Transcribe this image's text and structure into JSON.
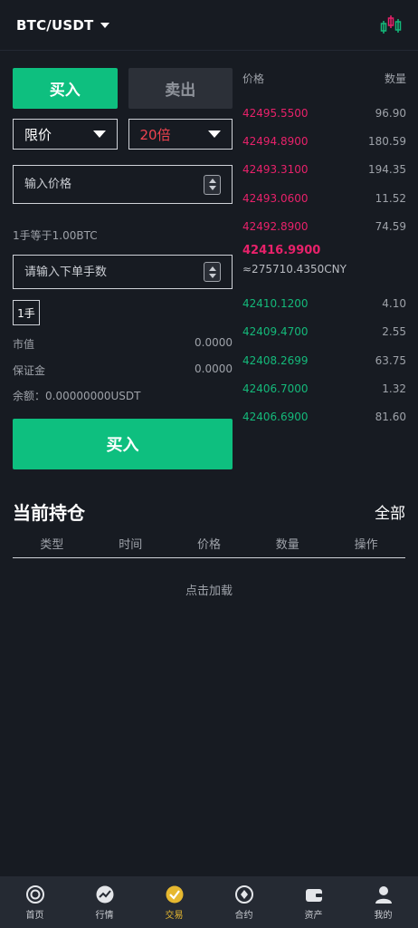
{
  "header": {
    "pair": "BTC/USDT"
  },
  "trade": {
    "tab_buy": "买入",
    "tab_sell": "卖出",
    "order_type": "限价",
    "leverage": "20倍",
    "price_placeholder": "输入价格",
    "lot_equivalence": "1手等于1.00BTC",
    "lots_placeholder": "请输入下单手数",
    "lot_button": "1手",
    "market_value_label": "市值",
    "market_value": "0.0000",
    "margin_label": "保证金",
    "margin": "0.0000",
    "balance": "余额：0.00000000USDT",
    "submit": "买入"
  },
  "orderbook": {
    "price_header": "价格",
    "qty_header": "数量",
    "asks": [
      {
        "price": "42495.5500",
        "qty": "96.90"
      },
      {
        "price": "42494.8900",
        "qty": "180.59"
      },
      {
        "price": "42493.3100",
        "qty": "194.35"
      },
      {
        "price": "42493.0600",
        "qty": "11.52"
      },
      {
        "price": "42492.8900",
        "qty": "74.59"
      }
    ],
    "last_price": "42416.9900",
    "last_cny": "≈275710.4350CNY",
    "bids": [
      {
        "price": "42410.1200",
        "qty": "4.10"
      },
      {
        "price": "42409.4700",
        "qty": "2.55"
      },
      {
        "price": "42408.2699",
        "qty": "63.75"
      },
      {
        "price": "42406.7000",
        "qty": "1.32"
      },
      {
        "price": "42406.6900",
        "qty": "81.60"
      }
    ]
  },
  "positions": {
    "title": "当前持仓",
    "all": "全部",
    "columns": [
      "类型",
      "时间",
      "价格",
      "数量",
      "操作"
    ],
    "load_more": "点击加载"
  },
  "nav": [
    {
      "label": "首页",
      "icon": "home-icon"
    },
    {
      "label": "行情",
      "icon": "market-icon"
    },
    {
      "label": "交易",
      "icon": "trade-icon",
      "active": true
    },
    {
      "label": "合约",
      "icon": "contract-icon"
    },
    {
      "label": "资产",
      "icon": "wallet-icon"
    },
    {
      "label": "我的",
      "icon": "user-icon"
    }
  ],
  "colors": {
    "buy": "#0ebf7f",
    "ask": "#e8216a",
    "bid": "#14b97a",
    "active_nav": "#e6b830",
    "background": "#171b22"
  }
}
